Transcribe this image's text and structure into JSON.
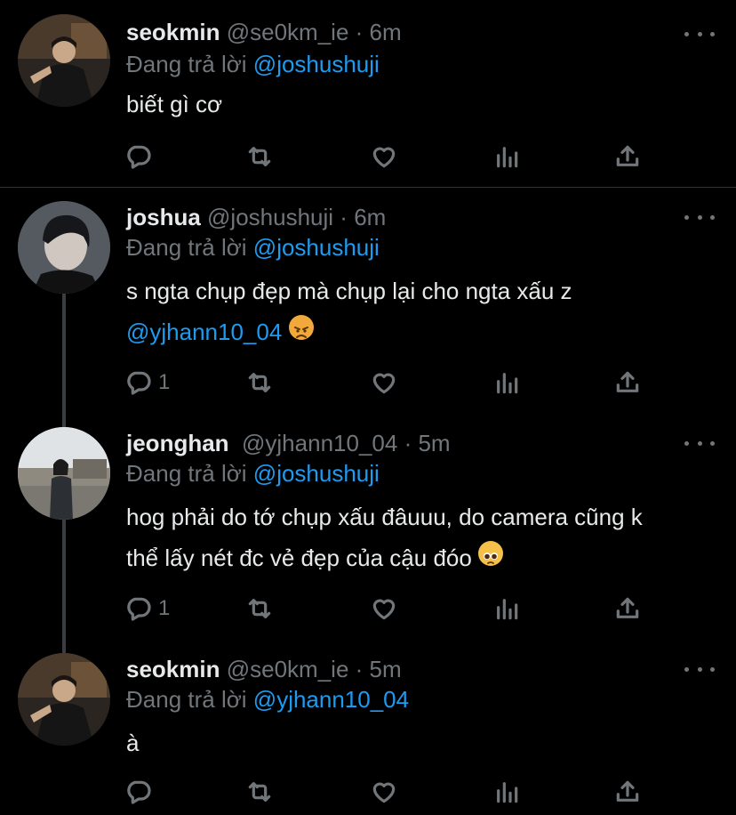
{
  "tweets": [
    {
      "name": "seokmin",
      "handle": "@se0km_ie",
      "dot": "·",
      "time": "6m",
      "reply_prefix": "Đang trả lời",
      "reply_to": "@joshushuji",
      "text_lines": [
        "biết gì cơ"
      ],
      "reply_count": "",
      "avatar_icon": "avatar-photo-seokmin"
    },
    {
      "name": "joshua",
      "handle": "@joshushuji",
      "dot": "·",
      "time": "6m",
      "reply_prefix": "Đang trả lời",
      "reply_to": "@joshushuji",
      "text_lines": [
        "s ngta chụp đẹp mà chụp lại cho ngta xấu z"
      ],
      "mention": "@yjhann10_04",
      "emoji": "angry-face-emoji",
      "reply_count": "1",
      "avatar_icon": "avatar-photo-joshua"
    },
    {
      "name": "jeonghan",
      "handle": "@yjhann10_04",
      "dot": "·",
      "time": "5m",
      "reply_prefix": "Đang trả lời",
      "reply_to": "@joshushuji",
      "text_lines": [
        "hog phải do tớ chụp xấu đâuuu, do camera cũng k",
        "thể lấy nét đc vẻ đẹp của cậu đóo"
      ],
      "emoji": "pleading-face-emoji",
      "reply_count": "1",
      "avatar_icon": "avatar-photo-jeonghan"
    },
    {
      "name": "seokmin",
      "handle": "@se0km_ie",
      "dot": "·",
      "time": "5m",
      "reply_prefix": "Đang trả lời",
      "reply_to": "@yjhann10_04",
      "text_lines": [
        "à"
      ],
      "reply_count": "",
      "avatar_icon": "avatar-photo-seokmin"
    }
  ],
  "colors": {
    "background": "#000000",
    "text": "#e7e9ea",
    "muted": "#71767b",
    "accent": "#1d9bf0",
    "divider": "#2f3336",
    "thread_line": "#3a3d41"
  },
  "icons": [
    "reply-icon",
    "retweet-icon",
    "like-icon",
    "analytics-icon",
    "share-icon",
    "more-icon"
  ]
}
